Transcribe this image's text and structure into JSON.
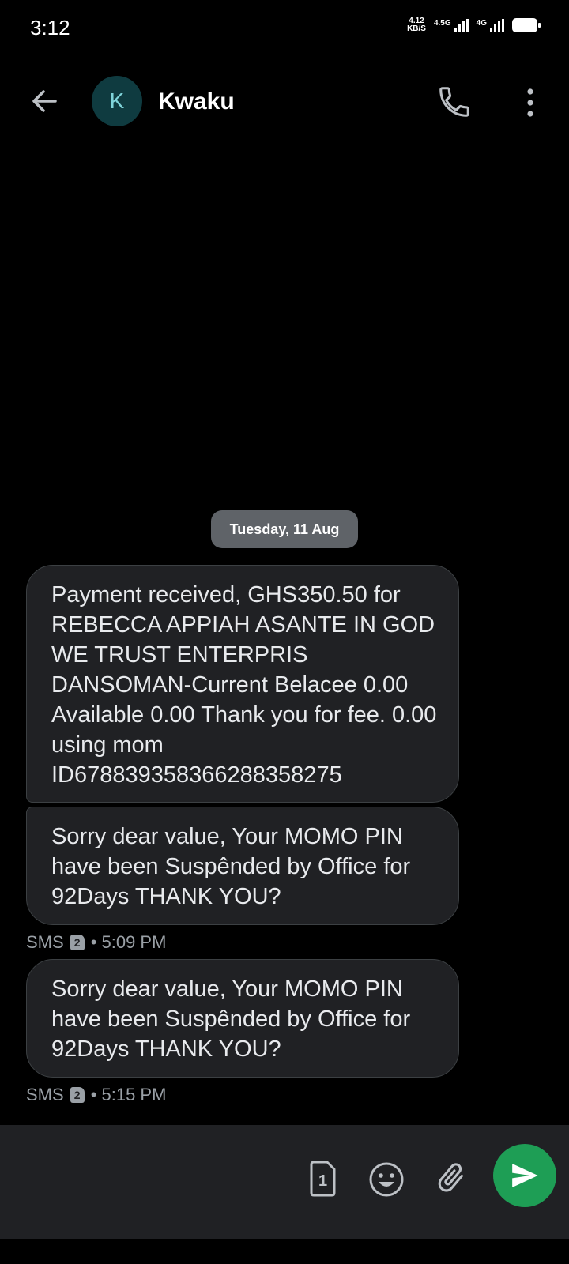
{
  "status_bar": {
    "time": "3:12",
    "net_speed_value": "4.12",
    "net_speed_unit": "KB/S",
    "sim1_label": "4.5G",
    "sim2_label": "4G"
  },
  "header": {
    "avatar_initial": "K",
    "contact_name": "Kwaku"
  },
  "date_chip": "Tuesday, 11 Aug",
  "messages": [
    {
      "text": "Payment received, GHS350.50 for REBECCA APPIAH ASANTE IN GOD WE TRUST ENTERPRIS DANSOMAN-Current Belacee 0.00 Available 0.00 Thank you for fee. 0.00 using mom ID678839358366288358275"
    },
    {
      "text": "Sorry dear value, Your MOMO PIN have been Suspênded by Office for 92Days THANK YOU?",
      "meta_type": "SMS",
      "sim_number": "2",
      "time": "• 5:09 PM"
    },
    {
      "text": "Sorry dear value, Your MOMO PIN have been Suspênded by Office for 92Days THANK YOU?",
      "meta_type": "SMS",
      "sim_number": "2",
      "time": "• 5:15 PM"
    }
  ],
  "compose": {
    "sim_selector_number": "1"
  },
  "colors": {
    "background": "#000000",
    "bubble": "#202124",
    "avatar_bg": "#0f3b40",
    "avatar_fg": "#7fd3d9",
    "date_chip": "#5f6368",
    "send_button": "#1e9e55",
    "meta_text": "#9aa0a6"
  },
  "icons": {
    "back": "arrow-back-icon",
    "call": "phone-icon",
    "more": "more-vert-icon",
    "sim": "sim-card-icon",
    "emoji": "emoji-icon",
    "attach": "attachment-icon",
    "send": "send-icon"
  }
}
